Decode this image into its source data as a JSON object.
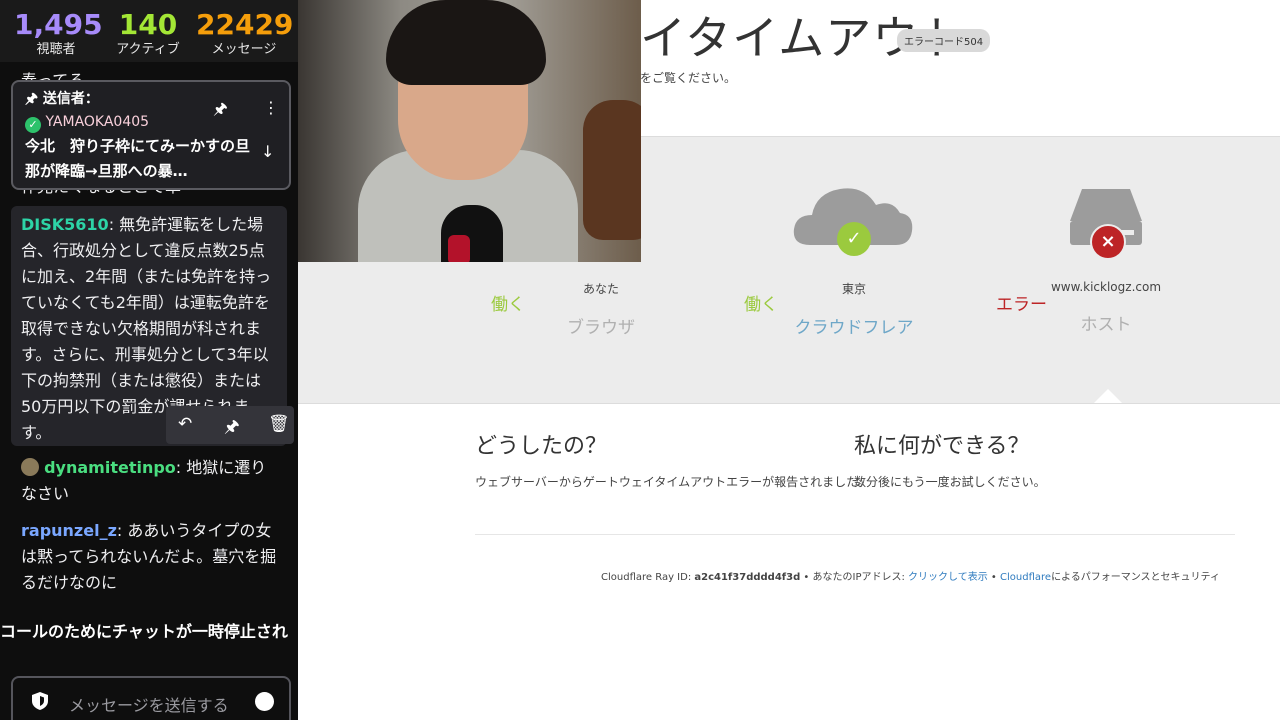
{
  "stats": {
    "viewers": {
      "value": "1,495",
      "label": "視聴者",
      "color": "#a78bfa"
    },
    "active": {
      "value": "140",
      "label": "アクティブ",
      "color": "#a3e635"
    },
    "messages": {
      "value": "22429",
      "label": "メッセージ",
      "color": "#f59e0b"
    }
  },
  "chat": {
    "top_cut": "奏ってる",
    "pinned": {
      "header": "送信者：",
      "user": "YAMAOKA0405",
      "text": "今北　狩り子枠にてみーかすの旦那が降臨→旦那への暴…"
    },
    "behind_pinned": "作見たくなるとこて草",
    "messages": [
      {
        "user": "DISK5610",
        "color": "#2dd4a7",
        "text": "無免許運転をした場合、行政処分として違反点数25点に加え、2年間（または免許を持っていなくても2年間）は運転免許を取得できない欠格期間が科されます。さらに、刑事処分として3年以下の拘禁刑（または懲役）または50万円以下の罰金が課せられます。"
      },
      {
        "user": "dynamitetinpo",
        "color": "#4ade80",
        "text": "地獄に遷りなさい"
      },
      {
        "user": "rapunzel_z",
        "color": "#7aa7ff",
        "text": "ああいうタイプの女は黙ってられないんだよ。墓穴を掘るだけなのに"
      }
    ],
    "system_message": "コールのためにチャットが一時停止され",
    "input_placeholder": "メッセージを送信する"
  },
  "cf": {
    "title": "イタイムアウト",
    "badge": "エラーコード504",
    "subtitle": "をご覧ください。",
    "nodes": [
      {
        "loc": "あなた",
        "what": "ブラウザ",
        "status": "働く"
      },
      {
        "loc": "東京",
        "what": "クラウドフレア",
        "status": "働く"
      },
      {
        "loc": "www.kicklogz.com",
        "what": "ホスト",
        "status": "エラー"
      }
    ],
    "what_h": "どうしたの？",
    "what_p": "ウェブサーバーからゲートウェイタイムアウトエラーが報告されました。",
    "can_h": "私に何ができる？",
    "can_p": "数分後にもう一度お試しください。",
    "footer": {
      "ray_label": "Cloudflare Ray ID: ",
      "ray_id": "a2c41f37dddd4f3d",
      "ip_label": " • あなたのIPアドレス: ",
      "ip_link": "クリックして表示",
      "sep": " • ",
      "cf_link": "Cloudflare",
      "perf": "によるパフォーマンスとセキュリティ"
    }
  }
}
